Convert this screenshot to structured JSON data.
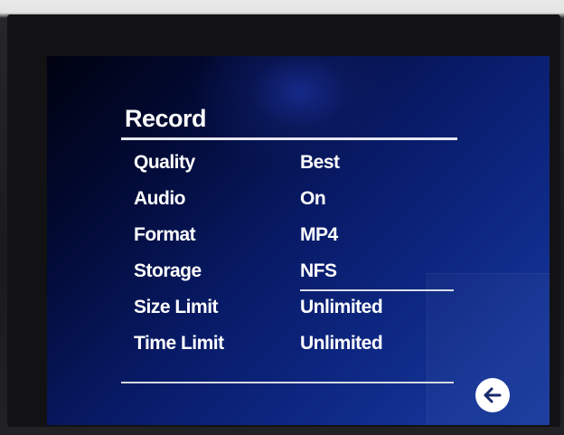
{
  "screen": {
    "title": "Record",
    "settings": [
      {
        "label": "Quality",
        "value": "Best"
      },
      {
        "label": "Audio",
        "value": "On"
      },
      {
        "label": "Format",
        "value": "MP4"
      },
      {
        "label": "Storage",
        "value": "NFS"
      },
      {
        "label": "Size Limit",
        "value": "Unlimited"
      },
      {
        "label": "Time Limit",
        "value": "Unlimited"
      }
    ],
    "back_icon": "arrow-left-icon",
    "colors": {
      "text": "#ffffff",
      "background_dark": "#020a33",
      "background_light": "#17399c",
      "button": "#ffffff"
    }
  }
}
